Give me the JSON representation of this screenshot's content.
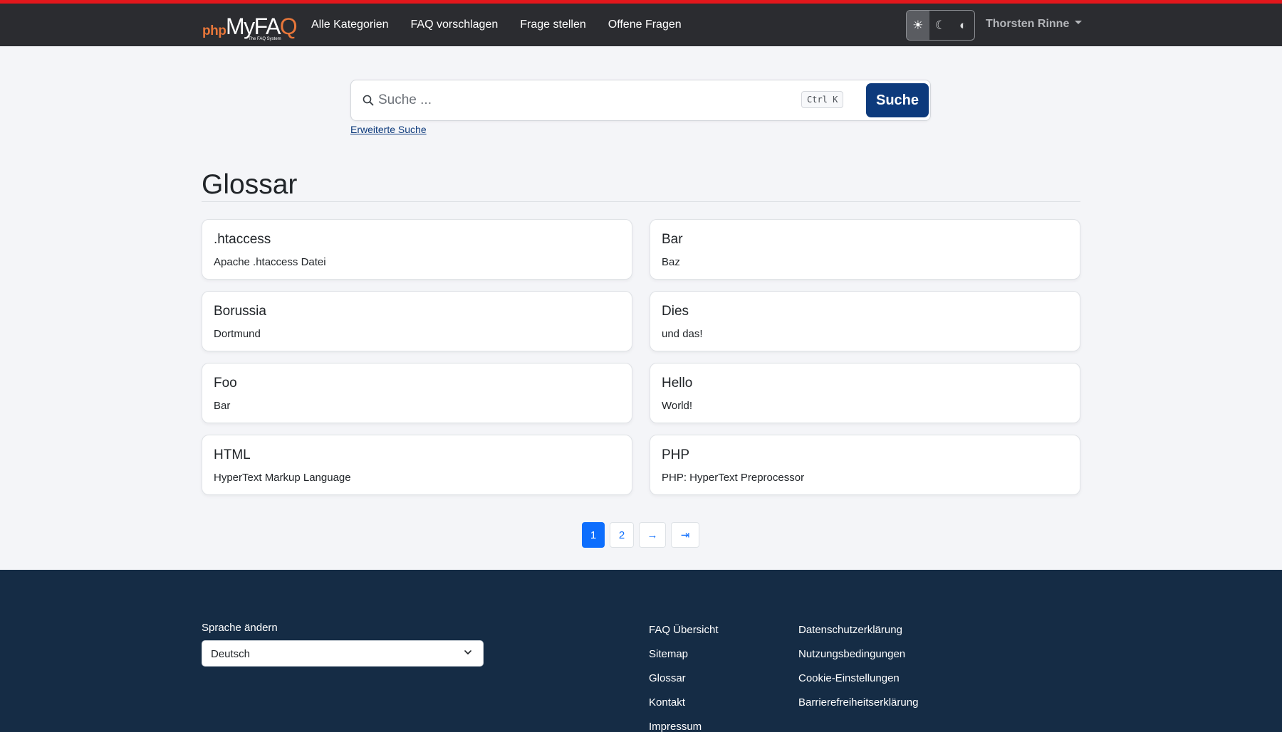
{
  "brand": {
    "php": "php",
    "myfa": "MyFA",
    "q": "Q",
    "tagline": "The FAQ System"
  },
  "nav": [
    "Alle Kategorien",
    "FAQ vorschlagen",
    "Frage stellen",
    "Offene Fragen"
  ],
  "theme": {
    "light": "☀",
    "dark": "☾",
    "auto": "◐"
  },
  "user": {
    "name": "Thorsten Rinne"
  },
  "search": {
    "placeholder": "Suche ...",
    "shortcut": "Ctrl K",
    "button": "Suche",
    "advanced": "Erweiterte Suche"
  },
  "glossary": {
    "title": "Glossar",
    "items": [
      {
        "term": ".htaccess",
        "definition": "Apache .htaccess Datei"
      },
      {
        "term": "Bar",
        "definition": "Baz"
      },
      {
        "term": "Borussia",
        "definition": "Dortmund"
      },
      {
        "term": "Dies",
        "definition": "und das!"
      },
      {
        "term": "Foo",
        "definition": "Bar"
      },
      {
        "term": "Hello",
        "definition": "World!"
      },
      {
        "term": "HTML",
        "definition": "HyperText Markup Language"
      },
      {
        "term": "PHP",
        "definition": "PHP: HyperText Preprocessor"
      }
    ]
  },
  "pagination": {
    "pages": [
      "1",
      "2"
    ],
    "next": "→",
    "last": "⇥",
    "current": "1"
  },
  "footer": {
    "language_label": "Sprache ändern",
    "language_value": "Deutsch",
    "links_col1": [
      "FAQ Übersicht",
      "Sitemap",
      "Glossar",
      "Kontakt",
      "Impressum"
    ],
    "links_col2": [
      "Datenschutzerklärung",
      "Nutzungsbedingungen",
      "Cookie-Einstellungen",
      "Barrierefreiheitserklärung"
    ]
  },
  "colors": {
    "accent_red": "#e3171c",
    "navbar": "#2b2c30",
    "primary": "#0d6efd",
    "search_button": "#0d3a7c",
    "footer": "#152c45",
    "brand_orange": "#e8773a"
  }
}
